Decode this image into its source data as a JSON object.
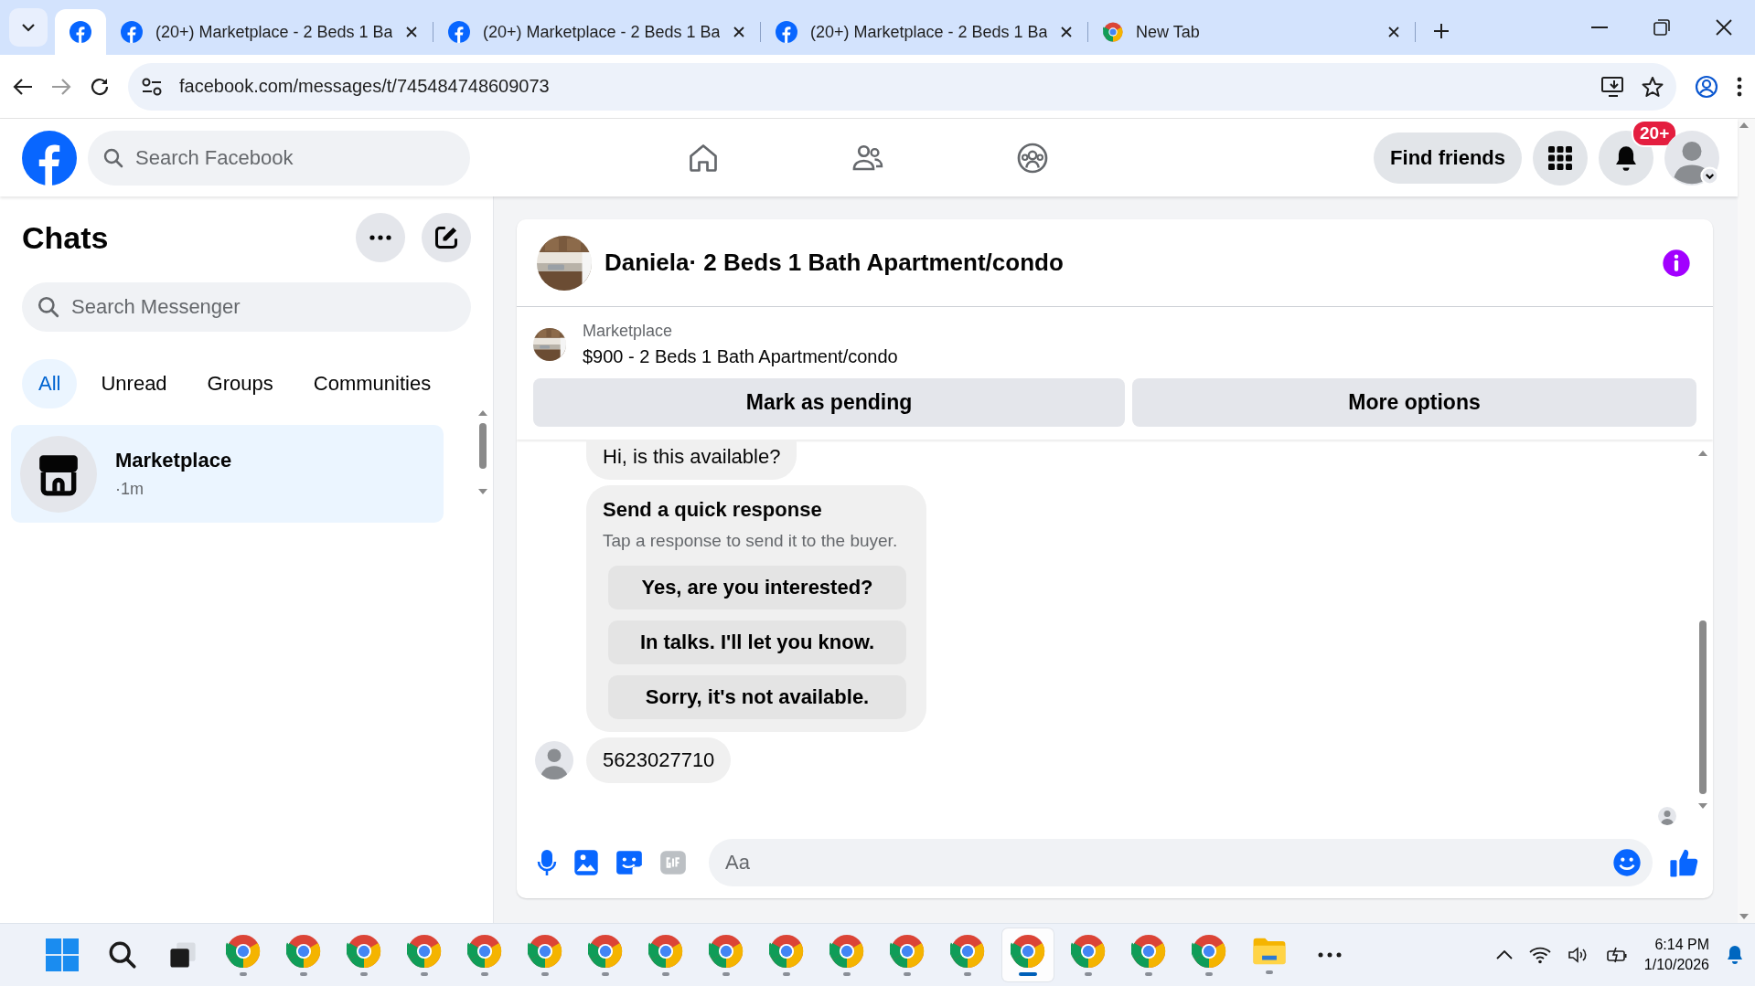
{
  "browser": {
    "tabs": [
      {
        "kind": "facebook",
        "selected": true
      },
      {
        "kind": "facebook",
        "title": "(20+) Marketplace - 2 Beds 1 Ba",
        "selected": false
      },
      {
        "kind": "facebook",
        "title": "(20+) Marketplace - 2 Beds 1 Ba",
        "selected": false
      },
      {
        "kind": "facebook",
        "title": "(20+) Marketplace - 2 Beds 1 Ba",
        "selected": false
      },
      {
        "kind": "chrome",
        "title": "New Tab",
        "selected": false
      }
    ],
    "url": "facebook.com/messages/t/745484748609073"
  },
  "header": {
    "search": {
      "placeholder": "Search Facebook"
    },
    "nav": [
      {
        "kind": "home"
      },
      {
        "kind": "friends"
      },
      {
        "kind": "groups"
      }
    ],
    "find_friends": "Find friends",
    "notification_badge": "20+"
  },
  "chats": {
    "title": "Chats",
    "search": {
      "placeholder": "Search Messenger"
    },
    "filters": [
      {
        "label": "All",
        "selected": true
      },
      {
        "label": "Unread",
        "selected": false
      },
      {
        "label": "Groups",
        "selected": false
      },
      {
        "label": "Communities",
        "selected": false
      }
    ],
    "conversations": [
      {
        "name": "Marketplace",
        "time": "·1m",
        "selected": true
      }
    ]
  },
  "conversation": {
    "title": "Daniela· 2 Beds 1 Bath Apartment/condo",
    "listing": {
      "source": "Marketplace",
      "title": "$900 - 2 Beds 1 Bath Apartment/condo"
    },
    "actions": [
      "Mark as pending",
      "More options"
    ],
    "messages": [
      {
        "kind": "text",
        "text": "Hi, is this available?",
        "avatar": false
      },
      {
        "kind": "quick_responses",
        "title": "Send a quick response",
        "subtitle": "Tap a response to send it to the buyer.",
        "options": [
          "Yes, are you interested?",
          "In talks. I'll let you know.",
          "Sorry, it's not available."
        ]
      },
      {
        "kind": "text",
        "text": "5623027710",
        "avatar": true
      }
    ],
    "composer": {
      "placeholder": "Aa"
    }
  },
  "taskbar": {
    "apps": [
      {
        "kind": "start",
        "selected": false
      },
      {
        "kind": "search",
        "selected": false
      },
      {
        "kind": "taskview",
        "selected": false
      },
      {
        "kind": "chrome",
        "selected": false
      },
      {
        "kind": "chrome",
        "selected": false
      },
      {
        "kind": "chrome",
        "selected": false
      },
      {
        "kind": "chrome",
        "selected": false
      },
      {
        "kind": "chrome",
        "selected": false
      },
      {
        "kind": "chrome",
        "selected": false
      },
      {
        "kind": "chrome",
        "selected": false
      },
      {
        "kind": "chrome",
        "selected": false
      },
      {
        "kind": "chrome",
        "selected": false
      },
      {
        "kind": "chrome",
        "selected": false
      },
      {
        "kind": "chrome",
        "selected": false
      },
      {
        "kind": "chrome",
        "selected": false
      },
      {
        "kind": "chrome",
        "selected": false
      },
      {
        "kind": "chrome",
        "selected": true
      },
      {
        "kind": "chrome",
        "selected": false
      },
      {
        "kind": "chrome",
        "selected": false
      },
      {
        "kind": "chrome",
        "selected": false
      },
      {
        "kind": "explorer",
        "selected": false
      },
      {
        "kind": "more",
        "selected": false
      }
    ],
    "time": "6:14 PM",
    "date": "1/10/2026"
  }
}
